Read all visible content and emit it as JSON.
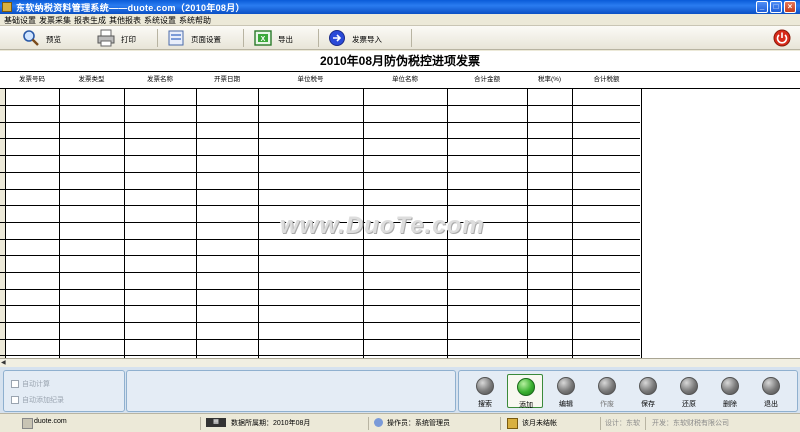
{
  "window": {
    "title": "东软纳税资料管理系统——duote.com（2010年08月）"
  },
  "menu": [
    "基础设置",
    "发票采集",
    "报表生成",
    "其他报表",
    "系统设置",
    "系统帮助"
  ],
  "toolbar": {
    "preview": "预览",
    "print": "打印",
    "page_setup": "页面设置",
    "export": "导出",
    "invoice_import": "发票导入"
  },
  "report": {
    "title": "2010年08月防伪税控进项发票",
    "columns": [
      "发票号码",
      "发票类型",
      "发票名称",
      "开票日期",
      "单位税号",
      "单位名称",
      "合计金额",
      "税率(%)",
      "合计税额"
    ]
  },
  "watermark": "www.DuoTe.com",
  "options": {
    "auto_calc": "自动计算",
    "auto_add": "自动添加纪录"
  },
  "actions": [
    "搜索",
    "添加",
    "编辑",
    "作废",
    "保存",
    "还原",
    "删除",
    "退出"
  ],
  "status": {
    "site": "duote.com",
    "period": "数据所属期：2010年08月",
    "operator": "操作员：系统管理员",
    "month_state": "该月未结帐",
    "design": "设计：东软",
    "company": "开发：东软财税有限公司"
  },
  "colors": {
    "titlebar": "#0a5bd8",
    "panel": "#d6e2ef",
    "selected_action": "#3ab030"
  }
}
